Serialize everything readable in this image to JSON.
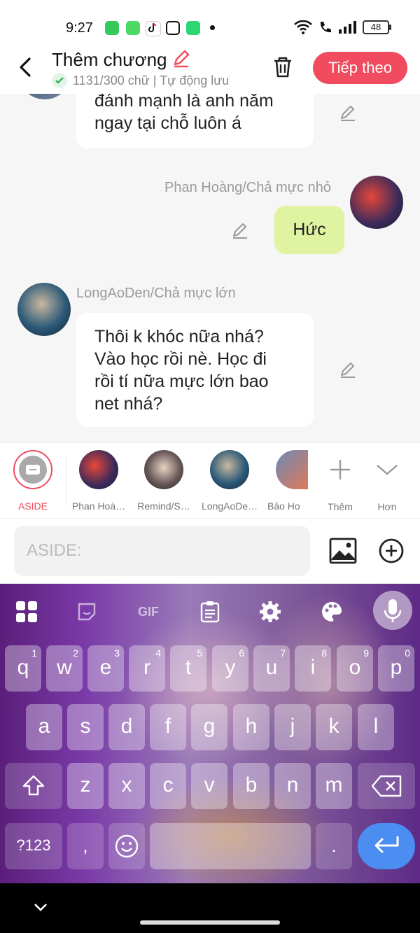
{
  "status_bar": {
    "time": "9:27",
    "battery": "48"
  },
  "header": {
    "title": "Thêm chương",
    "subtitle": "1131/300 chữ | Tự động lưu",
    "next_label": "Tiếp theo"
  },
  "chat": {
    "msg1": {
      "line1": "đánh mạnh là anh nằm",
      "line2": "ngay tại chỗ luôn á"
    },
    "msg2": {
      "sender": "Phan Hoàng/Chả mực nhỏ",
      "text": "Hức"
    },
    "msg3": {
      "sender": "LongAoDen/Chả mực lớn",
      "line1": "Thôi k khóc nữa nhá?",
      "line2": "Vào học rồi nè. Học đi",
      "line3": "rồi tí nữa mực lớn bao",
      "line4": "net nhá?"
    }
  },
  "characters": [
    {
      "name": "ASIDE"
    },
    {
      "name": "Phan Hoà…"
    },
    {
      "name": "Remind/S…"
    },
    {
      "name": "LongAoDe…"
    },
    {
      "name": "Bảo Ho"
    }
  ],
  "char_actions": {
    "more": "Thêm",
    "expand": "Hơn"
  },
  "input": {
    "placeholder": "ASIDE:"
  },
  "keyboard": {
    "gif": "GIF",
    "row1": [
      "q",
      "w",
      "e",
      "r",
      "t",
      "y",
      "u",
      "i",
      "o",
      "p"
    ],
    "row1_nums": [
      "1",
      "2",
      "3",
      "4",
      "5",
      "6",
      "7",
      "8",
      "9",
      "0"
    ],
    "row2": [
      "a",
      "s",
      "d",
      "f",
      "g",
      "h",
      "j",
      "k",
      "l"
    ],
    "row3": [
      "z",
      "x",
      "c",
      "v",
      "b",
      "n",
      "m"
    ],
    "symbols": "?123",
    "comma": ",",
    "period": "."
  },
  "colors": {
    "accent": "#f04b5f",
    "bubble_self": "#dff3a0",
    "enter": "#4b8df0"
  }
}
